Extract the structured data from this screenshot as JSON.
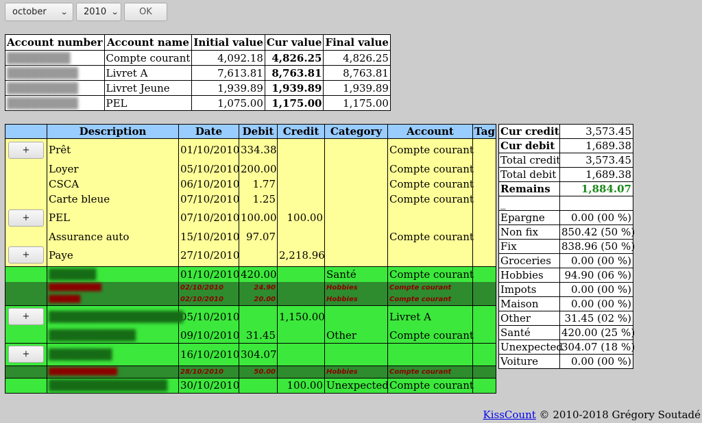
{
  "controls": {
    "month": "october",
    "year": "2010",
    "ok": "OK"
  },
  "accounts": {
    "headers": [
      "Account number",
      "Account name",
      "Initial value",
      "Cur value",
      "Final value"
    ],
    "rows": [
      {
        "name": "Compte courant",
        "initial": "4,092.18",
        "cur": "4,826.25",
        "final": "4,826.25"
      },
      {
        "name": "Livret A",
        "initial": "7,613.81",
        "cur": "8,763.81",
        "final": "8,763.81"
      },
      {
        "name": "Livret Jeune",
        "initial": "1,939.89",
        "cur": "1,939.89",
        "final": "1,939.89"
      },
      {
        "name": "PEL",
        "initial": "1,075.00",
        "cur": "1,175.00",
        "final": "1,175.00"
      }
    ]
  },
  "ops": {
    "headers": [
      "Description",
      "Date",
      "Debit",
      "Credit",
      "Category",
      "Account",
      "Tag"
    ],
    "add_label": "+",
    "rows": [
      {
        "desc": "Prêt",
        "date": "01/10/2010",
        "debit": "334.38",
        "credit": "",
        "category": "",
        "account": "Compte courant"
      },
      {
        "desc": "Loyer",
        "date": "05/10/2010",
        "debit": "200.00",
        "credit": "",
        "category": "",
        "account": "Compte courant"
      },
      {
        "desc": "CSCA",
        "date": "06/10/2010",
        "debit": "1.77",
        "credit": "",
        "category": "",
        "account": "Compte courant"
      },
      {
        "desc": "Carte bleue",
        "date": "07/10/2010",
        "debit": "1.25",
        "credit": "",
        "category": "",
        "account": "Compte courant"
      },
      {
        "desc": "PEL",
        "date": "07/10/2010",
        "debit": "100.00",
        "credit": "100.00",
        "category": "",
        "account": ""
      },
      {
        "desc": "Assurance auto",
        "date": "15/10/2010",
        "debit": "97.07",
        "credit": "",
        "category": "",
        "account": "Compte courant"
      },
      {
        "desc": "Paye",
        "date": "27/10/2010",
        "debit": "",
        "credit": "2,218.96",
        "category": "",
        "account": ""
      },
      {
        "date": "01/10/2010",
        "debit": "420.00",
        "credit": "",
        "category": "Santé",
        "account": "Compte courant"
      },
      {
        "date": "02/10/2010",
        "debit": "24.90",
        "credit": "",
        "category": "Hobbies",
        "account": "Compte courant"
      },
      {
        "date": "02/10/2010",
        "debit": "20.00",
        "credit": "",
        "category": "Hobbies",
        "account": "Compte courant"
      },
      {
        "date": "05/10/2010",
        "debit": "",
        "credit": "1,150.00",
        "category": "",
        "account": "Livret A"
      },
      {
        "date": "09/10/2010",
        "debit": "31.45",
        "credit": "",
        "category": "Other",
        "account": "Compte courant"
      },
      {
        "date": "16/10/2010",
        "debit": "304.07",
        "credit": "",
        "category": "",
        "account": ""
      },
      {
        "date": "28/10/2010",
        "debit": "50.00",
        "credit": "",
        "category": "Hobbies",
        "account": "Compte courant"
      },
      {
        "date": "30/10/2010",
        "debit": "",
        "credit": "100.00",
        "category": "Unexpected",
        "account": "Compte courant"
      }
    ]
  },
  "stats": {
    "totals": [
      {
        "label": "Cur credit",
        "value": "3,573.45"
      },
      {
        "label": "Cur debit",
        "value": "1,689.38"
      },
      {
        "label": "Total credit",
        "value": "3,573.45"
      },
      {
        "label": "Total debit",
        "value": "1,689.38"
      },
      {
        "label": "Remains",
        "value": "1,884.07"
      }
    ],
    "separator": "_",
    "categories": [
      {
        "label": "Epargne",
        "value": "0.00 (00 %)"
      },
      {
        "label": "Non fix",
        "value": "850.42 (50 %)"
      },
      {
        "label": "Fix",
        "value": "838.96 (50 %)"
      },
      {
        "label": "Groceries",
        "value": "0.00 (00 %)"
      },
      {
        "label": "Hobbies",
        "value": "94.90 (06 %)"
      },
      {
        "label": "Impots",
        "value": "0.00 (00 %)"
      },
      {
        "label": "Maison",
        "value": "0.00 (00 %)"
      },
      {
        "label": "Other",
        "value": "31.45 (02 %)"
      },
      {
        "label": "Santé",
        "value": "420.00 (25 %)"
      },
      {
        "label": "Unexpected",
        "value": "304.07 (18 %)"
      },
      {
        "label": "Voiture",
        "value": "0.00 (00 %)"
      }
    ],
    "colors": {
      "remains": "#1a8a1a"
    }
  },
  "footer": {
    "link": "KissCount",
    "text": " © 2010-2018 Grégory Soutadé"
  },
  "colors": {
    "header_blue": "#99ccff",
    "fixed_yellow": "#ffff99",
    "variable_green": "#3ce83c",
    "pending_dark_green": "#2e8b2e"
  }
}
